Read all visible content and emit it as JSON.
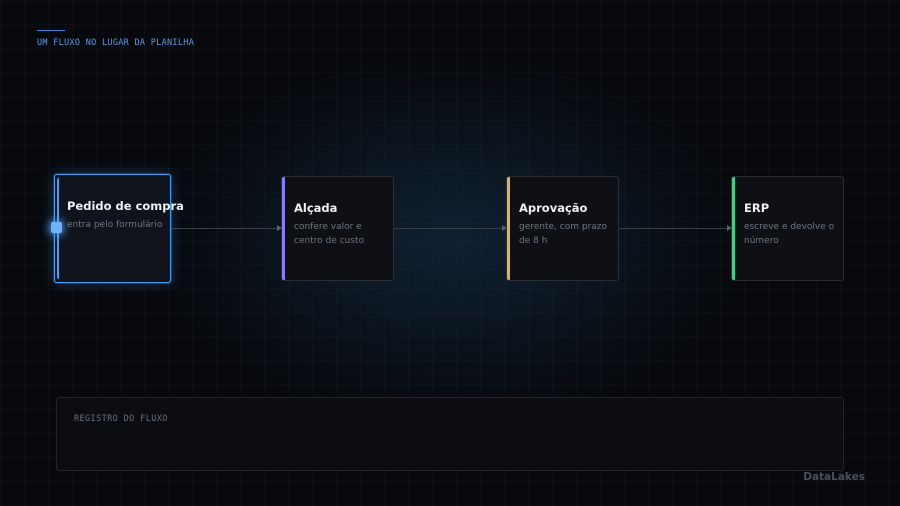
{
  "header": {
    "eyebrow": "UM FLUXO NO LUGAR DA PLANILHA"
  },
  "flow": {
    "steps": [
      {
        "title": "Pedido de compra",
        "description": "entra pelo formulário",
        "accent": "#4a9ef0",
        "active": true
      },
      {
        "title": "Alçada",
        "description": "confere valor e centro de custo",
        "accent": "#8b7cf6",
        "active": false
      },
      {
        "title": "Aprovação",
        "description": "gerente, com prazo de 8 h",
        "accent": "#e6b04a",
        "active": false
      },
      {
        "title": "ERP",
        "description": "escreve e devolve o número",
        "accent": "#3ecf8e",
        "active": false
      }
    ]
  },
  "log": {
    "title": "REGISTRO DO FLUXO"
  },
  "brand": {
    "name": "DataLakes"
  }
}
